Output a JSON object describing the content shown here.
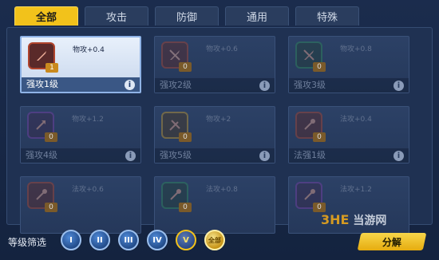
{
  "tabs": [
    {
      "label": "全部",
      "active": true
    },
    {
      "label": "攻击",
      "active": false
    },
    {
      "label": "防御",
      "active": false
    },
    {
      "label": "通用",
      "active": false
    },
    {
      "label": "特殊",
      "active": false
    }
  ],
  "cards": [
    {
      "name": "强攻1级",
      "bonus": "物攻+0.4",
      "count": "1",
      "selected": true
    },
    {
      "name": "强攻2级",
      "bonus": "物攻+0.6",
      "count": "0",
      "selected": false
    },
    {
      "name": "强攻3级",
      "bonus": "物攻+0.8",
      "count": "0",
      "selected": false
    },
    {
      "name": "强攻4级",
      "bonus": "物攻+1.2",
      "count": "0",
      "selected": false
    },
    {
      "name": "强攻5级",
      "bonus": "物攻+2",
      "count": "0",
      "selected": false
    },
    {
      "name": "法强1级",
      "bonus": "法攻+0.4",
      "count": "0",
      "selected": false
    },
    {
      "name": "",
      "bonus": "法攻+0.6",
      "count": "0",
      "selected": false
    },
    {
      "name": "",
      "bonus": "法攻+0.8",
      "count": "0",
      "selected": false
    },
    {
      "name": "",
      "bonus": "法攻+1.2",
      "count": "0",
      "selected": false
    }
  ],
  "info_glyph": "i",
  "filter": {
    "label": "等级筛选",
    "levels": [
      "I",
      "II",
      "III",
      "IV",
      "V",
      "全部"
    ]
  },
  "decompose_label": "分解",
  "watermark": {
    "mark": "3HE",
    "text": "当游网"
  },
  "colors": {
    "accent": "#f2c21b",
    "panel": "#1f3152"
  }
}
